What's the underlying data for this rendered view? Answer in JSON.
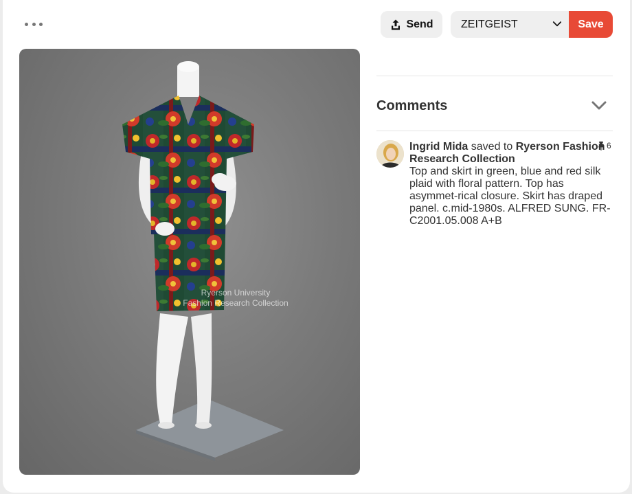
{
  "toolbar": {
    "more_icon": "more-horizontal-icon",
    "send_label": "Send",
    "send_icon": "share-upload-icon",
    "board_selected": "ZEITGEIST",
    "board_icon": "chevron-down-icon",
    "save_label": "Save",
    "save_color": "#e84a36"
  },
  "pin": {
    "watermark_line1": "Ryerson University",
    "watermark_line2": "Fashion Research Collection",
    "fullscreen_icon": "fullscreen-icon"
  },
  "comments": {
    "title": "Comments",
    "toggle_icon": "chevron-down-icon"
  },
  "activity": {
    "user_name": "Ingrid Mida",
    "action_text": " saved to ",
    "board_name": "Ryerson Fashion Research Collection",
    "description": "Top and skirt in green, blue and red silk plaid with floral pattern. Top has asymmet-rical closure. Skirt has draped panel. c.mid-1980s. ALFRED SUNG. FR-C2001.05.008 A+B",
    "pin_icon": "pushpin-icon",
    "pin_count": "6"
  }
}
